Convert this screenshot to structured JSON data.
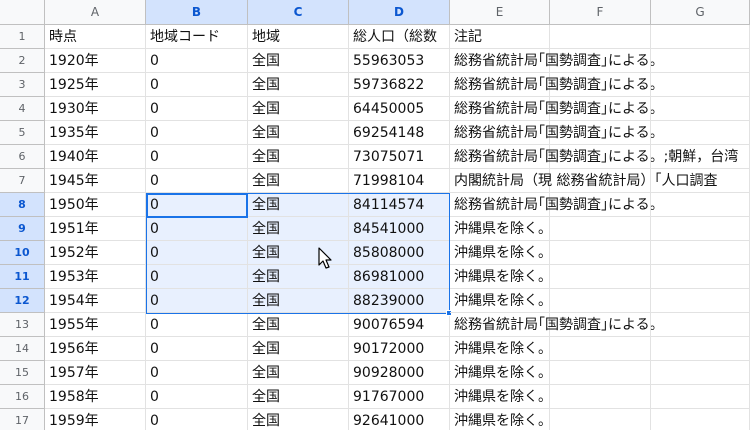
{
  "columns": [
    "A",
    "B",
    "C",
    "D",
    "E",
    "F",
    "G"
  ],
  "selected_columns": [
    "B",
    "C",
    "D"
  ],
  "header_row": {
    "num": "1",
    "cells": [
      "時点",
      "地域コード",
      "地域",
      "総人口（総数",
      "注記"
    ]
  },
  "rows": [
    {
      "num": "2",
      "cells": [
        "1920年",
        "0",
        "全国",
        "55963053",
        "総務省統計局｢国勢調査｣による。"
      ]
    },
    {
      "num": "3",
      "cells": [
        "1925年",
        "0",
        "全国",
        "59736822",
        "総務省統計局｢国勢調査｣による。"
      ]
    },
    {
      "num": "4",
      "cells": [
        "1930年",
        "0",
        "全国",
        "64450005",
        "総務省統計局｢国勢調査｣による。"
      ]
    },
    {
      "num": "5",
      "cells": [
        "1935年",
        "0",
        "全国",
        "69254148",
        "総務省統計局｢国勢調査｣による。"
      ]
    },
    {
      "num": "6",
      "cells": [
        "1940年",
        "0",
        "全国",
        "73075071",
        "総務省統計局｢国勢調査｣による。;朝鮮，台湾"
      ]
    },
    {
      "num": "7",
      "cells": [
        "1945年",
        "0",
        "全国",
        "71998104",
        "内閣統計局（現 総務省統計局）「人口調査"
      ]
    },
    {
      "num": "8",
      "cells": [
        "1950年",
        "0",
        "全国",
        "84114574",
        "総務省統計局｢国勢調査｣による。"
      ]
    },
    {
      "num": "9",
      "cells": [
        "1951年",
        "0",
        "全国",
        "84541000",
        "沖縄県を除く。"
      ]
    },
    {
      "num": "10",
      "cells": [
        "1952年",
        "0",
        "全国",
        "85808000",
        "沖縄県を除く。"
      ]
    },
    {
      "num": "11",
      "cells": [
        "1953年",
        "0",
        "全国",
        "86981000",
        "沖縄県を除く。"
      ]
    },
    {
      "num": "12",
      "cells": [
        "1954年",
        "0",
        "全国",
        "88239000",
        "沖縄県を除く。"
      ]
    },
    {
      "num": "13",
      "cells": [
        "1955年",
        "0",
        "全国",
        "90076594",
        "総務省統計局｢国勢調査｣による。"
      ]
    },
    {
      "num": "14",
      "cells": [
        "1956年",
        "0",
        "全国",
        "90172000",
        "沖縄県を除く。"
      ]
    },
    {
      "num": "15",
      "cells": [
        "1957年",
        "0",
        "全国",
        "90928000",
        "沖縄県を除く。"
      ]
    },
    {
      "num": "16",
      "cells": [
        "1958年",
        "0",
        "全国",
        "91767000",
        "沖縄県を除く。"
      ]
    },
    {
      "num": "17",
      "cells": [
        "1959年",
        "0",
        "全国",
        "92641000",
        "沖縄県を除く。"
      ]
    }
  ],
  "selection": {
    "active_cell": "B8",
    "range": "B8:D12"
  },
  "colors": {
    "selection_border": "#1a73e8",
    "selection_fill": "#e8f0fe",
    "header_bg": "#f8f9fa",
    "header_selected_bg": "#d3e3fd"
  }
}
